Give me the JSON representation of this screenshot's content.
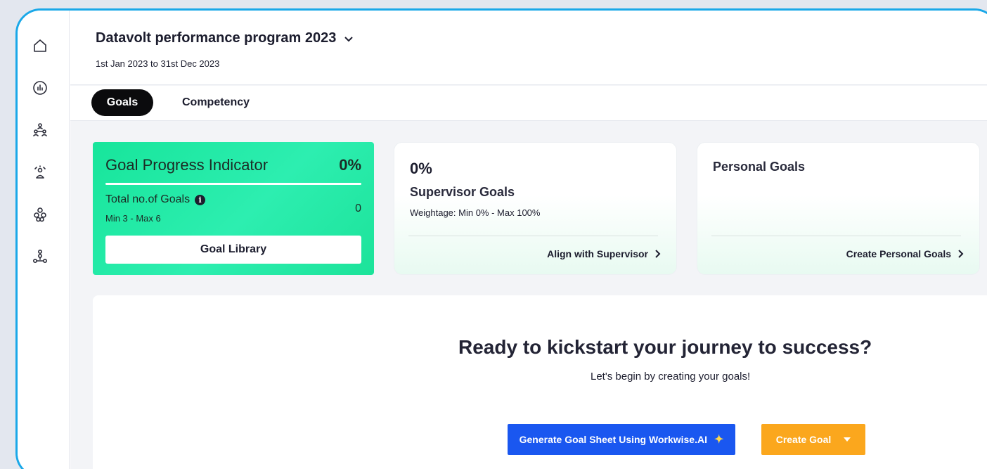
{
  "sidebar": {
    "icons": [
      "home-icon",
      "analytics-icon",
      "team-icon",
      "people-icon",
      "modules-icon",
      "org-chart-icon"
    ]
  },
  "header": {
    "program_title": "Datavolt performance program 2023",
    "dates": "1st Jan 2023 to 31st Dec 2023"
  },
  "tabs": {
    "active": "Goals",
    "inactive": "Competency"
  },
  "goal_progress": {
    "title": "Goal Progress Indicator",
    "percent": "0%",
    "total_label": "Total no.of Goals",
    "info_glyph": "i",
    "count": "0",
    "range": "Min 3 - Max 6",
    "library_button": "Goal Library"
  },
  "supervisor_card": {
    "percent": "0%",
    "title": "Supervisor Goals",
    "weightage": "Weightage: Min 0% - Max 100%",
    "link": "Align with Supervisor"
  },
  "personal_card": {
    "title": "Personal Goals",
    "link": "Create Personal Goals"
  },
  "empty_state": {
    "headline": "Ready to kickstart your journey to success?",
    "subhead": "Let's begin by creating your goals!",
    "generate_button": "Generate Goal Sheet Using Workwise.AI",
    "create_button": "Create Goal"
  },
  "colors": {
    "frame_border": "#1aa8e8",
    "gpi_card": "#17e59b",
    "generate_button": "#1a57f0",
    "create_button": "#fba71d",
    "tab_active": "#0b0b0d"
  }
}
